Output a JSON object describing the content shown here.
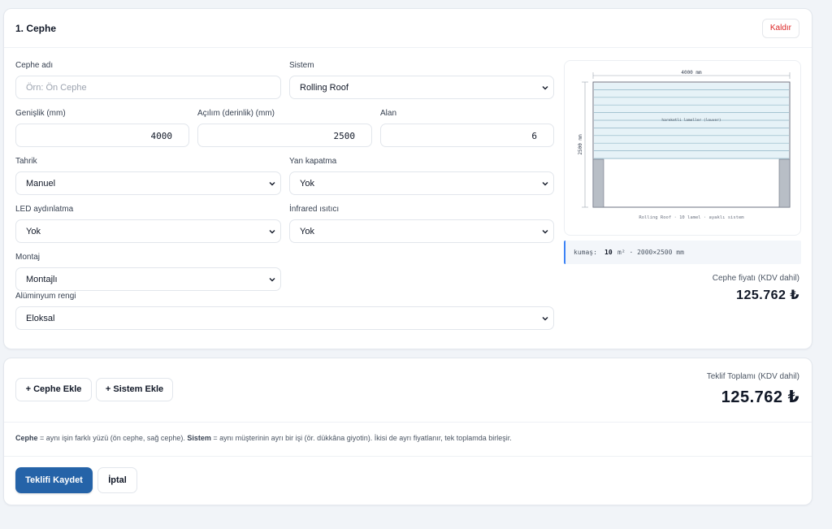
{
  "facade": {
    "title": "1. Cephe",
    "remove_label": "Kaldır",
    "fields": {
      "name": {
        "label": "Cephe adı",
        "value": "",
        "placeholder": "Örn: Ön Cephe"
      },
      "system": {
        "label": "Sistem",
        "value": "Rolling Roof"
      },
      "width": {
        "label": "Genişlik (mm)",
        "value": "4000"
      },
      "depth": {
        "label": "Açılım (derinlik) (mm)",
        "value": "2500"
      },
      "area": {
        "label": "Alan",
        "value": "6"
      },
      "drive": {
        "label": "Tahrik",
        "value": "Manuel"
      },
      "side_cover": {
        "label": "Yan kapatma",
        "value": "Yok"
      },
      "led": {
        "label": "LED aydınlatma",
        "value": "Yok"
      },
      "infrared": {
        "label": "İnfrared ısıtıcı",
        "value": "Yok"
      },
      "mounting": {
        "label": "Montaj",
        "value": "Montajlı"
      },
      "color": {
        "label": "Alüminyum rengi",
        "value": "Eloksal"
      }
    },
    "preview": {
      "width_label": "4000 mm",
      "depth_label": "2500 mm",
      "louver_label": "hareketli lameller (louver)",
      "caption": "Rolling Roof · 10 lamel · ayaklı sistem",
      "lamel_count": 10
    },
    "fabric": {
      "prefix": "kumaş:",
      "value": "10",
      "suffix": "m² · 2000×2500 mm"
    },
    "price": {
      "label": "Cephe fiyatı (KDV dahil)",
      "value": "125.762 ₺"
    }
  },
  "summary": {
    "add_facade_label": "+ Cephe Ekle",
    "add_system_label": "+ Sistem Ekle",
    "total_label": "Teklif Toplamı (KDV dahil)",
    "total_value": "125.762 ₺",
    "help": {
      "term1": "Cephe",
      "text1": " = aynı işin farklı yüzü (ön cephe, sağ cephe). ",
      "term2": "Sistem",
      "text2": " = aynı müşterinin ayrı bir işi (ör. dükkâna giyotin). İkisi de ayrı fiyatlanır, tek toplamda birleşir."
    },
    "save_label": "Teklifi Kaydet",
    "cancel_label": "İptal"
  },
  "colors": {
    "primary": "#2563a8",
    "danger": "#dc2626",
    "louver_fill": "#e6f2f7",
    "post": "#b8bec6"
  }
}
